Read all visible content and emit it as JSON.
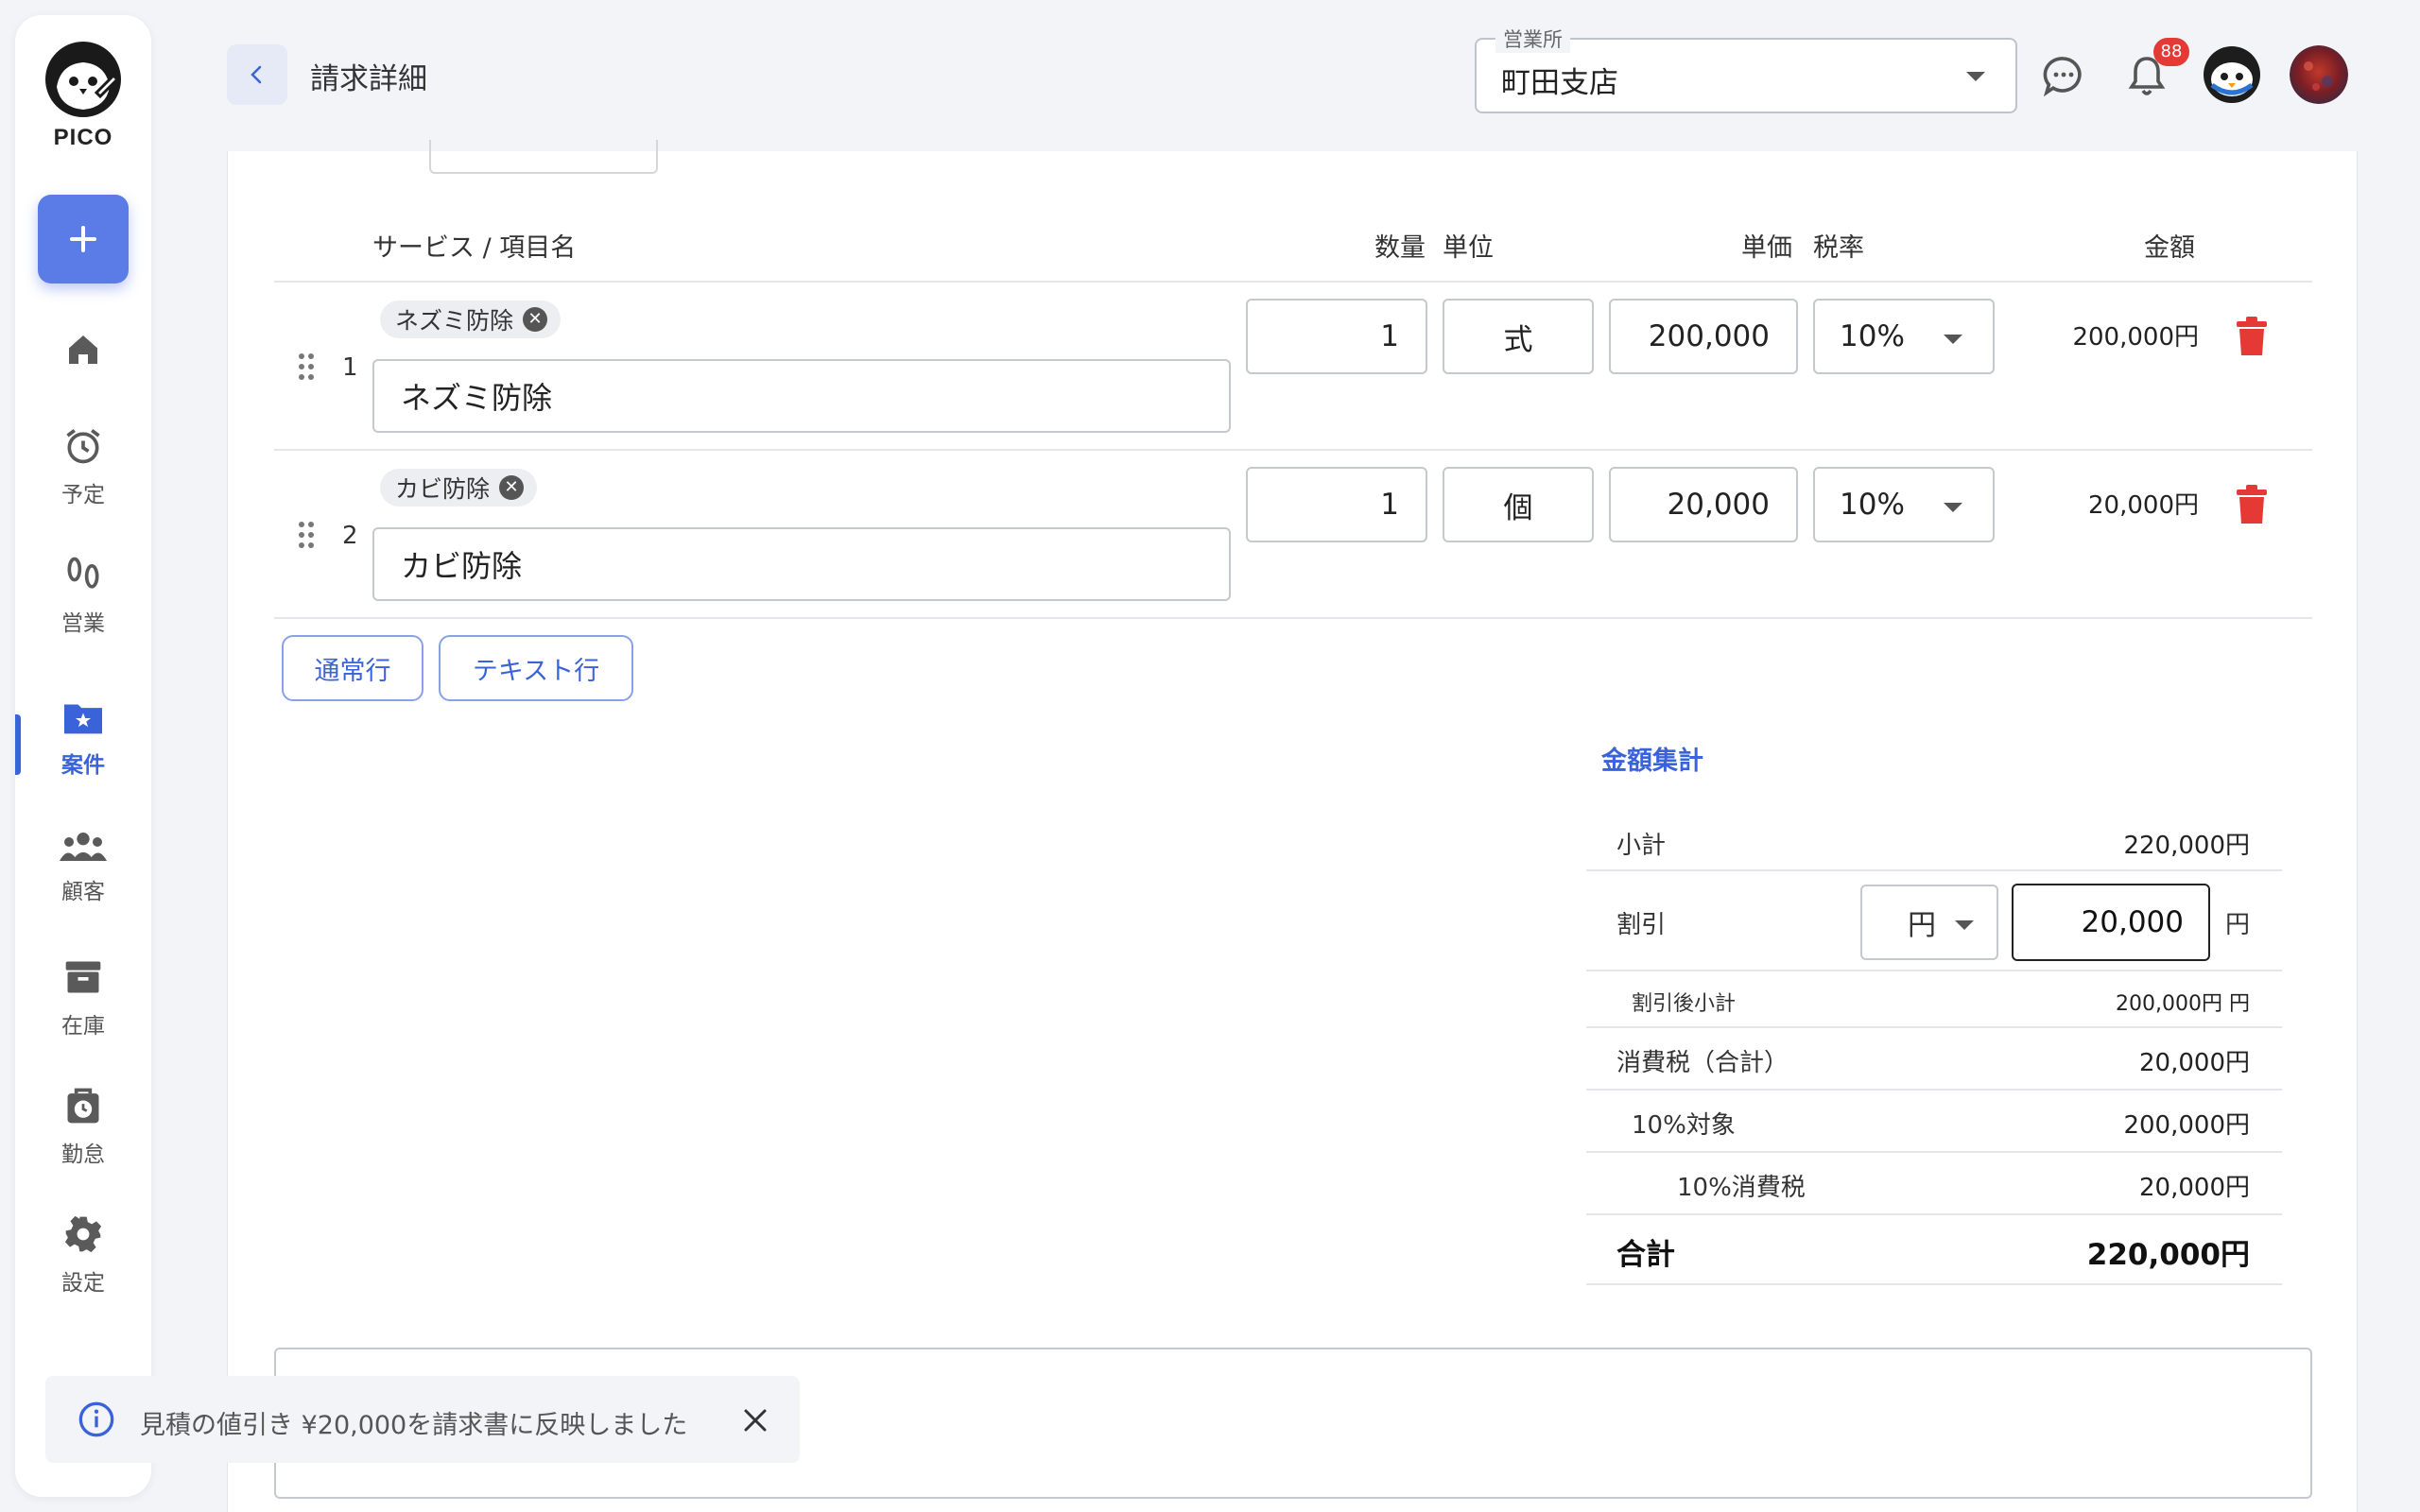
{
  "app": {
    "logo_text": "PICO"
  },
  "sidebar": {
    "items": [
      {
        "label": ""
      },
      {
        "label": "予定"
      },
      {
        "label": "営業"
      },
      {
        "label": "案件"
      },
      {
        "label": "顧客"
      },
      {
        "label": "在庫"
      },
      {
        "label": "勤怠"
      },
      {
        "label": "設定"
      }
    ],
    "active": "案件"
  },
  "header": {
    "title": "請求詳細",
    "office_label": "営業所",
    "office_value": "町田支店",
    "notification_count": "88"
  },
  "table": {
    "headers": {
      "service": "サービス / 項目名",
      "qty": "数量",
      "unit": "単位",
      "price": "単価",
      "tax": "税率",
      "amount": "金額"
    },
    "rows": [
      {
        "num": "1",
        "tag": "ネズミ防除",
        "name": "ネズミ防除",
        "qty": "1",
        "unit": "式",
        "price": "200,000",
        "tax": "10%",
        "amount": "200,000円"
      },
      {
        "num": "2",
        "tag": "カビ防除",
        "name": "カビ防除",
        "qty": "1",
        "unit": "個",
        "price": "20,000",
        "tax": "10%",
        "amount": "20,000円"
      }
    ],
    "add_buttons": {
      "normal": "通常行",
      "text": "テキスト行"
    }
  },
  "summary": {
    "title": "金額集計",
    "subtotal_label": "小計",
    "subtotal_value": "220,000円",
    "discount_label": "割引",
    "discount_type": "円",
    "discount_value": "20,000",
    "discount_unit": "円",
    "after_discount_label": "割引後小計",
    "after_discount_value": "200,000円 円",
    "tax_total_label": "消費税（合計）",
    "tax_total_value": "20,000円",
    "taxable_label": "10%対象",
    "taxable_value": "200,000円",
    "tax10_label": "10%消費税",
    "tax10_value": "20,000円",
    "total_label": "合計",
    "total_value": "220,000円"
  },
  "toast": {
    "message": "見積の値引き ¥20,000を請求書に反映しました"
  },
  "colors": {
    "accent": "#3b63d9",
    "danger": "#e53935",
    "add_button": "#5b7ce6"
  }
}
